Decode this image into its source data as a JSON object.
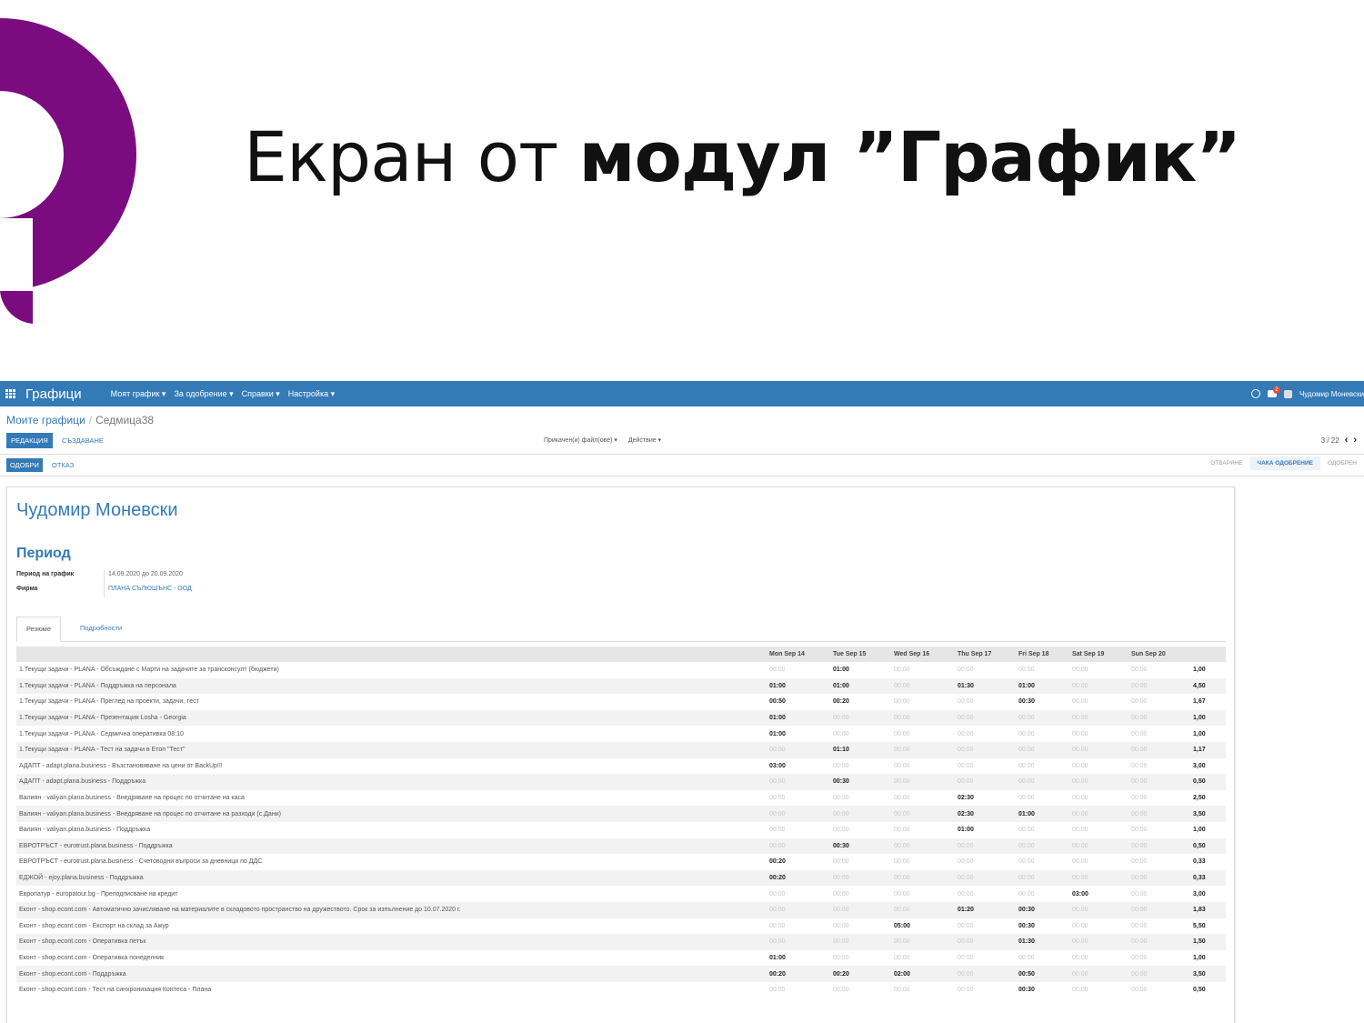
{
  "slide": {
    "title_regular": "Екран от ",
    "title_bold": "модул ”График”"
  },
  "navbar": {
    "app_name": "Графици",
    "menu": [
      "Моят график ▾",
      "За одобрение ▾",
      "Справки ▾",
      "Настройка ▾"
    ],
    "notification_count": "2",
    "user": "Чудомир Моневски"
  },
  "breadcrumb": {
    "parent": "Моите графици",
    "current": "Седмица38"
  },
  "toolbar": {
    "edit_label": "РЕДАКЦИЯ",
    "create_label": "СЪЗДАВАНЕ",
    "attachments_label": "Прикачен(и) файл(ове) ▾",
    "action_label": "Действие ▾",
    "pager": "3 / 22",
    "prev": "‹",
    "next": "›"
  },
  "statusbar": {
    "approve_label": "ОДОБРИ",
    "refuse_label": "ОТКАЗ",
    "stages": [
      "ОТВАРЯНЕ",
      "ЧАКА ОДОБРЕНИЕ",
      "ОДОБРЕН"
    ],
    "active_stage": "ЧАКА ОДОБРЕНИЕ"
  },
  "sheet": {
    "employee": "Чудомир Моневски",
    "section": "Период",
    "period_label": "Период на график",
    "period_value": "14.09.2020 до 20.09.2020",
    "company_label": "Фирма",
    "company_value": "ПЛАНА СЪЛЮШЪНС - ООД",
    "tabs": [
      "Резюме",
      "Подробности"
    ]
  },
  "colors": {
    "navbar": "#337ab7",
    "logo": "#7b0c80"
  },
  "table": {
    "days": [
      "Mon Sep 14",
      "Tue Sep 15",
      "Wed Sep 16",
      "Thu Sep 17",
      "Fri Sep 18",
      "Sat Sep 19",
      "Sun Sep 20"
    ],
    "rows": [
      {
        "name": "1.Текущи задачи - PLANA - Обсъждане с Марти на задачите за трансконсулт (бюджети)",
        "cells": [
          "00:00",
          "01:00",
          "00:00",
          "00:00",
          "00:00",
          "00:00",
          "00:00"
        ],
        "total": "1,00"
      },
      {
        "name": "1.Текущи задачи - PLANA - Поддръжка на персонала",
        "cells": [
          "01:00",
          "01:00",
          "00:00",
          "01:30",
          "01:00",
          "00:00",
          "00:00"
        ],
        "total": "4,50"
      },
      {
        "name": "1.Текущи задачи - PLANA - Преглед на проекти, задачи, тест",
        "cells": [
          "00:50",
          "00:20",
          "00:00",
          "00:00",
          "00:30",
          "00:00",
          "00:00"
        ],
        "total": "1,67"
      },
      {
        "name": "1.Текущи задачи - PLANA - Презентация Losha - Georgia",
        "cells": [
          "01:00",
          "00:00",
          "00:00",
          "00:00",
          "00:00",
          "00:00",
          "00:00"
        ],
        "total": "1,00"
      },
      {
        "name": "1.Текущи задачи - PLANA - Седмична оперативка 08:10",
        "cells": [
          "01:00",
          "00:00",
          "00:00",
          "00:00",
          "00:00",
          "00:00",
          "00:00"
        ],
        "total": "1,00"
      },
      {
        "name": "1.Текущи задачи - PLANA - Тест на задачи в Етоп \"Тест\"",
        "cells": [
          "00:00",
          "01:10",
          "00:00",
          "00:00",
          "00:00",
          "00:00",
          "00:00"
        ],
        "total": "1,17"
      },
      {
        "name": "АДАПТ - adapt.plana.business - Възстановяване на цени от BackUp!!!",
        "cells": [
          "03:00",
          "00:00",
          "00:00",
          "00:00",
          "00:00",
          "00:00",
          "00:00"
        ],
        "total": "3,00"
      },
      {
        "name": "АДАПТ - adapt.plana.business - Поддръжка",
        "cells": [
          "00:00",
          "00:30",
          "00:00",
          "00:00",
          "00:00",
          "00:00",
          "00:00"
        ],
        "total": "0,50"
      },
      {
        "name": "Валиян - valiyan.plana.business - Внедряване на процес по отчитане на каса",
        "cells": [
          "00:00",
          "00:00",
          "00:00",
          "02:30",
          "00:00",
          "00:00",
          "00:00"
        ],
        "total": "2,50"
      },
      {
        "name": "Валиян - valiyan.plana.business - Внедряване на процес по отчитане на разходи (с.Дани)",
        "cells": [
          "00:00",
          "00:00",
          "00:00",
          "02:30",
          "01:00",
          "00:00",
          "00:00"
        ],
        "total": "3,50"
      },
      {
        "name": "Валиян - valiyan.plana.business - Поддръжка",
        "cells": [
          "00:00",
          "00:00",
          "00:00",
          "01:00",
          "00:00",
          "00:00",
          "00:00"
        ],
        "total": "1,00"
      },
      {
        "name": "ЕВРОТРЪСТ - eurotrust.plana.business - Поддръжка",
        "cells": [
          "00:00",
          "00:30",
          "00:00",
          "00:00",
          "00:00",
          "00:00",
          "00:00"
        ],
        "total": "0,50"
      },
      {
        "name": "ЕВРОТРЪСТ - eurotrust.plana.business - Счетоводни въпроси за дневници по ДДС",
        "cells": [
          "00:20",
          "00:00",
          "00:00",
          "00:00",
          "00:00",
          "00:00",
          "00:00"
        ],
        "total": "0,33"
      },
      {
        "name": "ЕДЖОЙ - ejoy.plana.business - Поддръжка",
        "cells": [
          "00:20",
          "00:00",
          "00:00",
          "00:00",
          "00:00",
          "00:00",
          "00:00"
        ],
        "total": "0,33"
      },
      {
        "name": "Европатур - europatour.bg - Преподписване на кредит",
        "cells": [
          "00:00",
          "00:00",
          "00:00",
          "00:00",
          "00:00",
          "03:00",
          "00:00"
        ],
        "total": "3,00"
      },
      {
        "name": "Еконт - shop.econt.com - Автоматично зачисляване на материалите в складовото пространство на дружеството. Срок за изпълнение до 10.07.2020 г.",
        "cells": [
          "00:00",
          "00:00",
          "00:00",
          "01:20",
          "00:30",
          "00:00",
          "00:00"
        ],
        "total": "1,83"
      },
      {
        "name": "Еконт - shop.econt.com - Експорт на склад за Ажур",
        "cells": [
          "00:00",
          "00:00",
          "05:00",
          "00:00",
          "00:30",
          "00:00",
          "00:00"
        ],
        "total": "5,50"
      },
      {
        "name": "Еконт - shop.econt.com - Оперативка петък",
        "cells": [
          "00:00",
          "00:00",
          "00:00",
          "00:00",
          "01:30",
          "00:00",
          "00:00"
        ],
        "total": "1,50"
      },
      {
        "name": "Еконт - shop.econt.com - Оперативка понеделник",
        "cells": [
          "01:00",
          "00:00",
          "00:00",
          "00:00",
          "00:00",
          "00:00",
          "00:00"
        ],
        "total": "1,00"
      },
      {
        "name": "Еконт - shop.econt.com - Поддръжка",
        "cells": [
          "00:20",
          "00:20",
          "02:00",
          "00:00",
          "00:50",
          "00:00",
          "00:00"
        ],
        "total": "3,50"
      },
      {
        "name": "Еконт - shop.econt.com - Тест на синхронизация Контеса - Плана",
        "cells": [
          "00:00",
          "00:00",
          "00:00",
          "00:00",
          "00:30",
          "00:00",
          "00:00"
        ],
        "total": "0,50"
      }
    ]
  }
}
